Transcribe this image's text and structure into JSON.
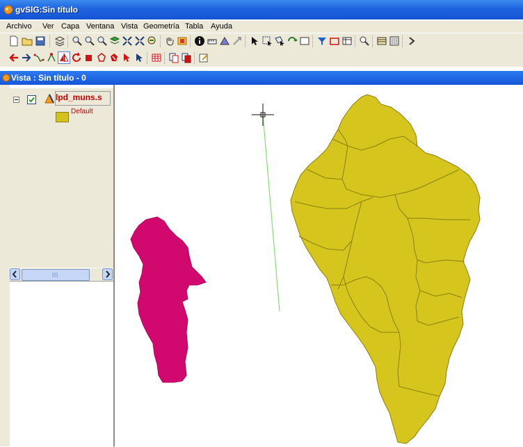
{
  "window": {
    "title": "gvSIG:Sin título"
  },
  "menu": [
    "Archivo",
    "Ver",
    "Capa",
    "Ventana",
    "Vista",
    "Geometría",
    "Tabla",
    "Ayuda"
  ],
  "view": {
    "title": "Vista : Sin título - 0"
  },
  "toc": {
    "layer": {
      "name": "lpd_muns.s",
      "visible": true,
      "expanded": true
    },
    "legend": {
      "label": "Default",
      "color": "#d4c21c"
    }
  },
  "colors": {
    "polygon_fill": "#d6c51c",
    "polygon_edge": "#8a7f10",
    "selected_fill": "#d1086e",
    "title_bar": "#1f63df",
    "panel": "#ece9d8",
    "line_tool": "#7ee26a"
  }
}
